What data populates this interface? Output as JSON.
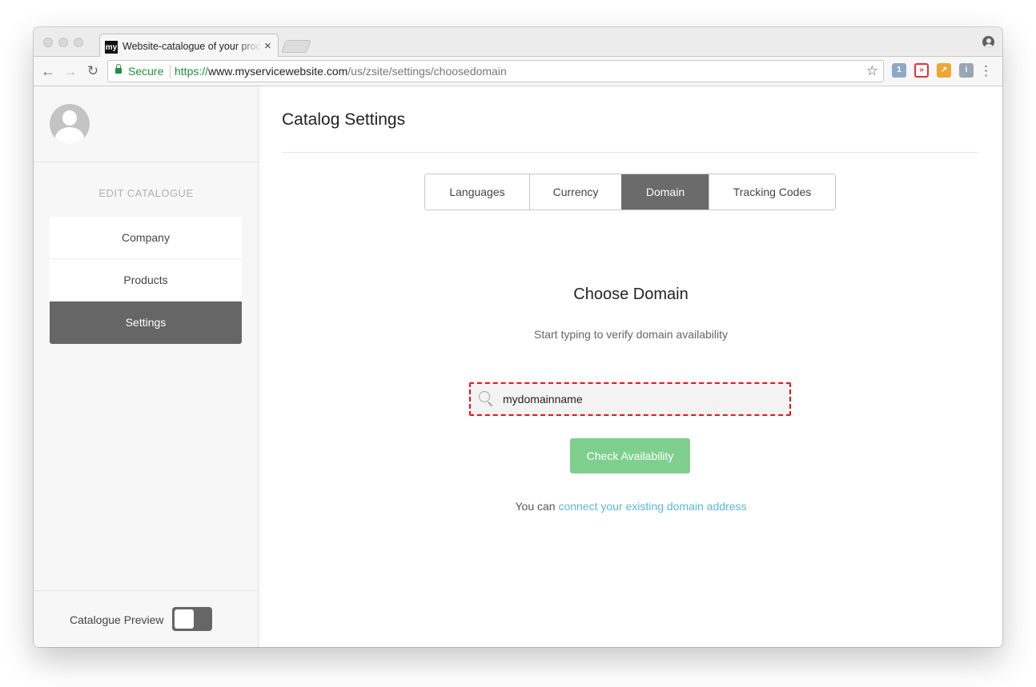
{
  "browser": {
    "tab_title": "Website-catalogue of your products",
    "tab_favicon_text": "my",
    "secure_label": "Secure",
    "url_scheme": "https://",
    "url_host": "www.myservicewebsite.com",
    "url_path": "/us/zsite/settings/choosedomain"
  },
  "sidebar": {
    "section_label": "EDIT CATALOGUE",
    "items": [
      {
        "label": "Company",
        "active": false
      },
      {
        "label": "Products",
        "active": false
      },
      {
        "label": "Settings",
        "active": true
      }
    ],
    "preview_label": "Catalogue Preview",
    "preview_toggle_on": false
  },
  "main": {
    "title": "Catalog Settings",
    "tabs": [
      {
        "label": "Languages",
        "active": false
      },
      {
        "label": "Currency",
        "active": false
      },
      {
        "label": "Domain",
        "active": true
      },
      {
        "label": "Tracking Codes",
        "active": false
      }
    ],
    "choose_title": "Choose Domain",
    "choose_subtitle": "Start typing to verify domain availability",
    "search_value": "mydomainname",
    "check_button": "Check Availability",
    "connect_prefix": "You can ",
    "connect_link": "connect your existing domain address"
  },
  "colors": {
    "accent_green": "#7fd08e",
    "active_gray": "#666666",
    "link_blue": "#5bb8d8",
    "highlight_red": "#e8141b",
    "secure_green": "#1e8e3e"
  },
  "icons": [
    "back-arrow-icon",
    "forward-arrow-icon",
    "reload-icon",
    "lock-icon",
    "star-icon",
    "profile-icon",
    "menu-dots-icon",
    "search-icon",
    "avatar-icon"
  ]
}
